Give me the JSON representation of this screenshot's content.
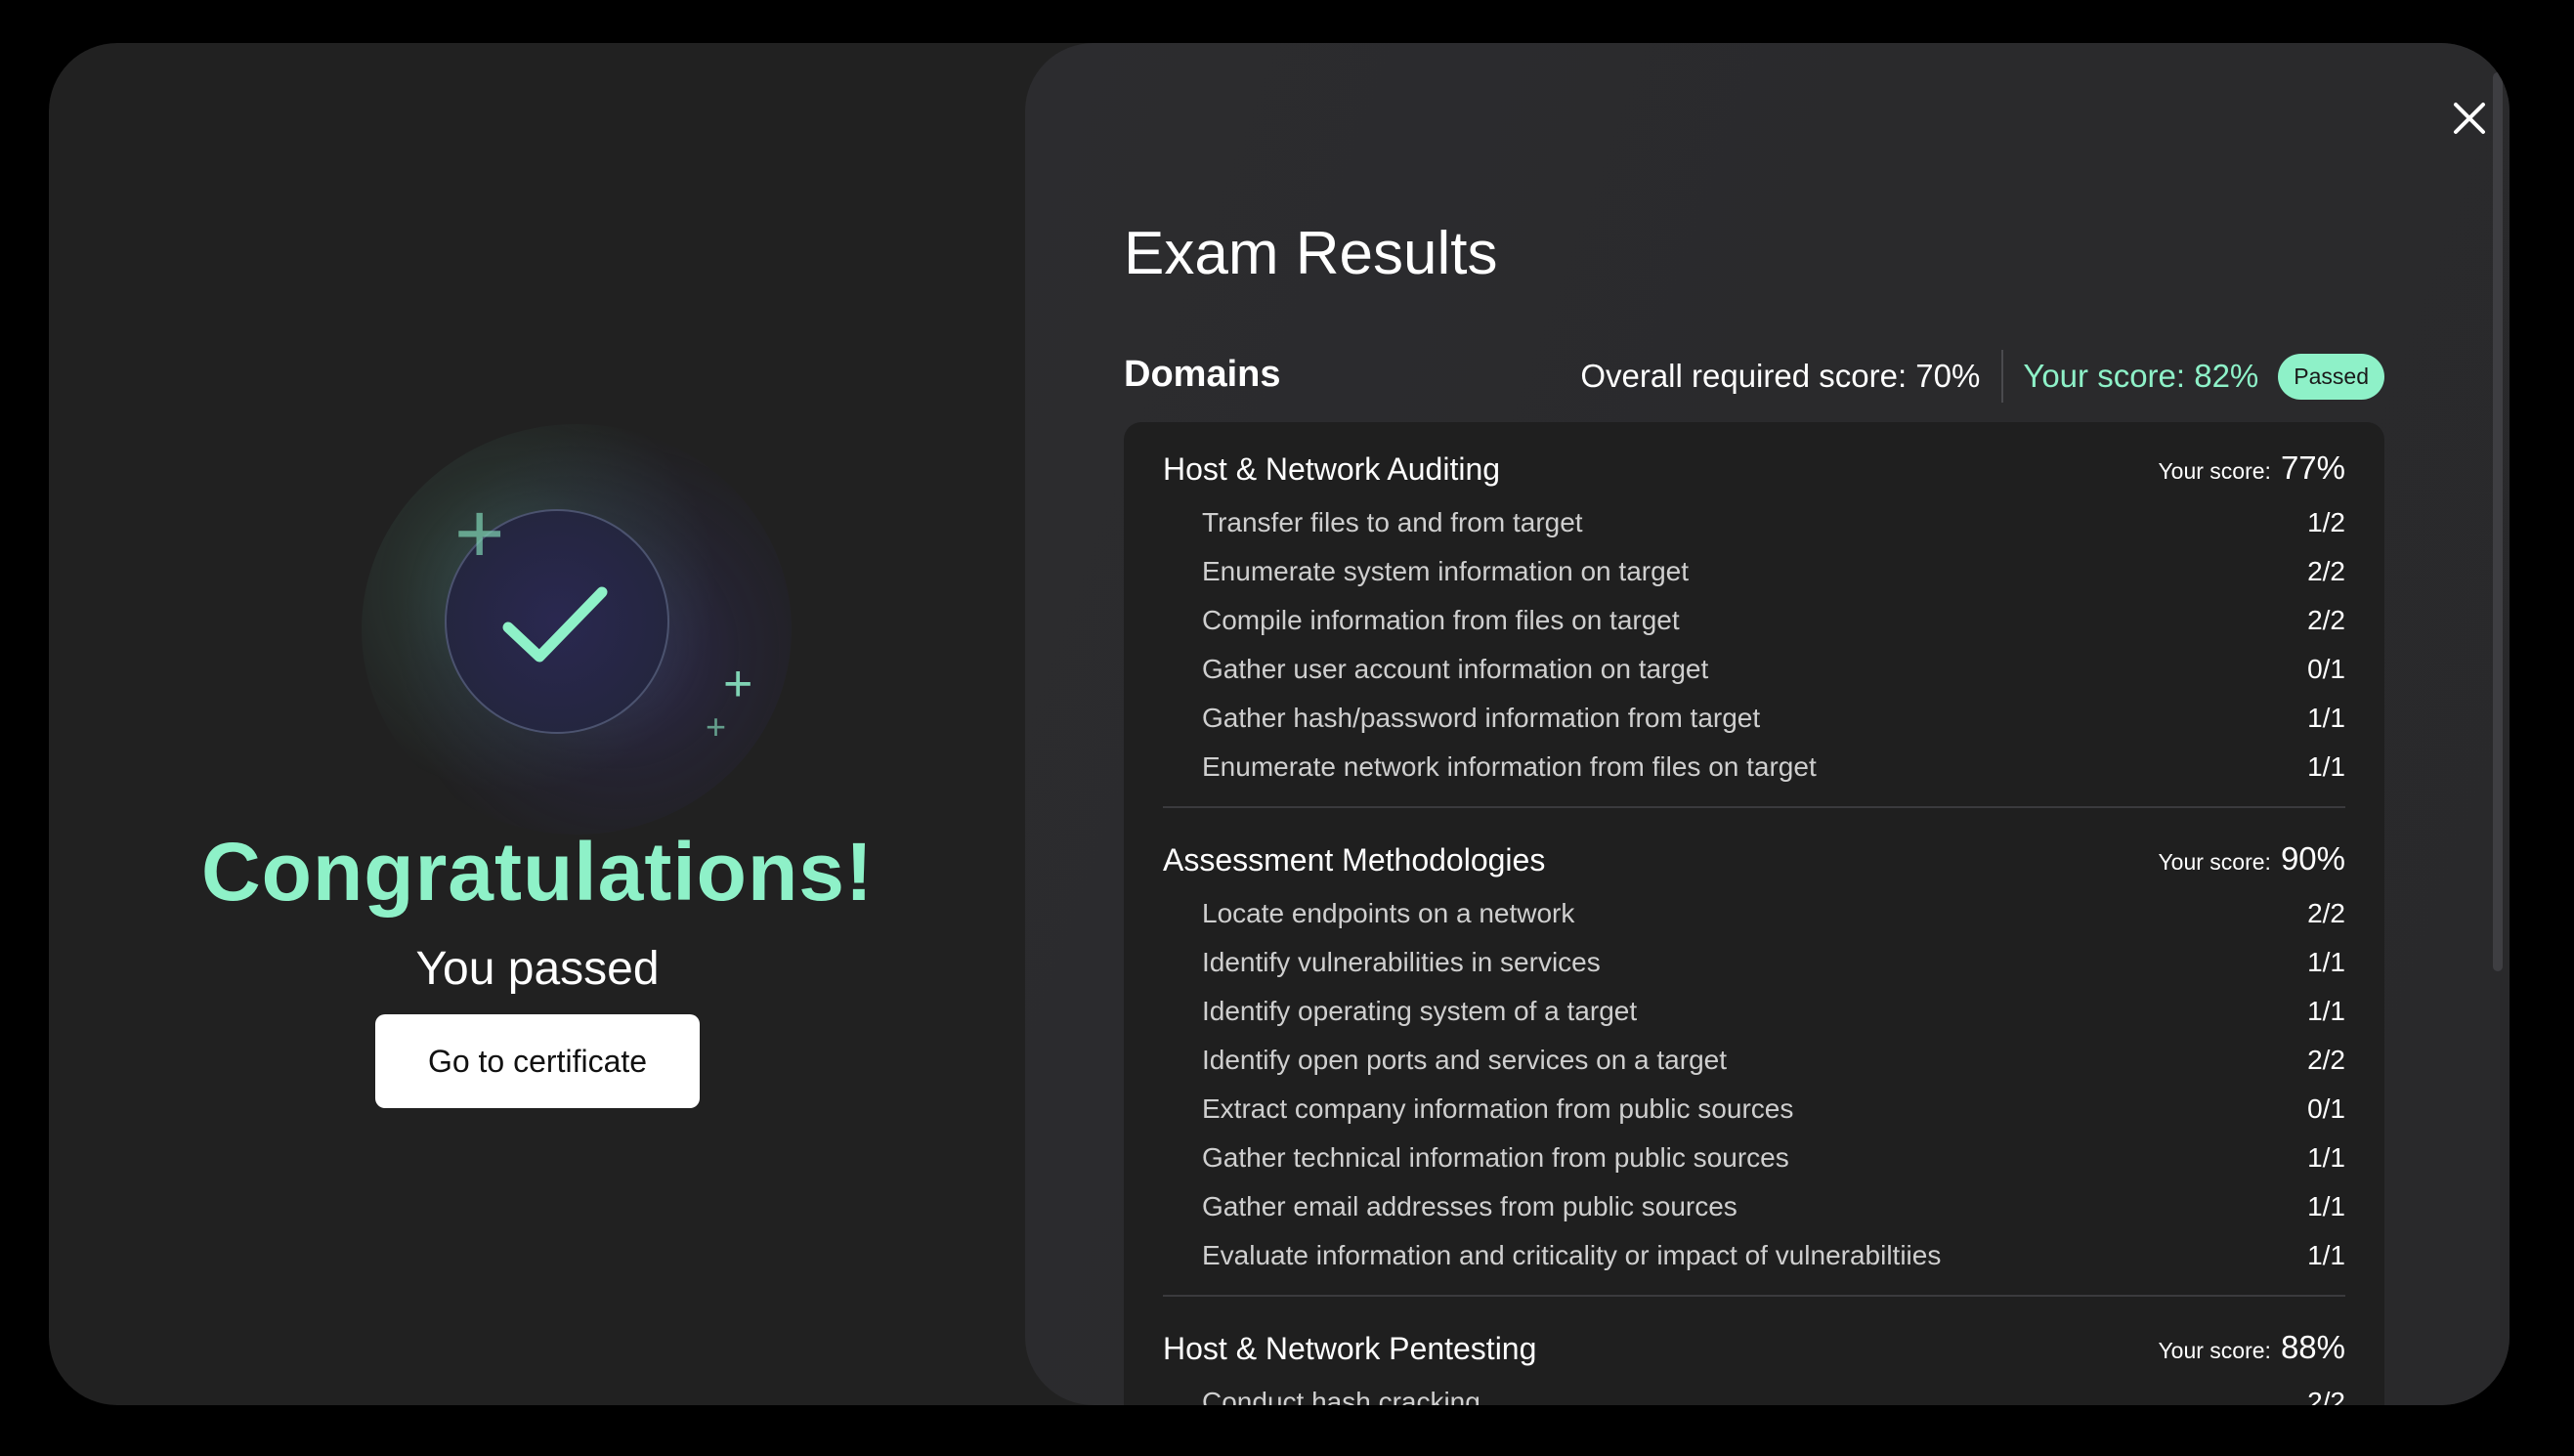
{
  "left": {
    "congrats": "Congratulations!",
    "subtitle": "You passed",
    "button_label": "Go to certificate",
    "icons": {
      "badge": "check-icon",
      "sparkles": "plus-sparkle-icon"
    }
  },
  "right": {
    "title": "Exam Results",
    "domains_label": "Domains",
    "required_score": "Overall required score: 70%",
    "your_score": "Your score: 82%",
    "status_badge": "Passed",
    "close_icon": "close-icon",
    "domains": [
      {
        "name": "Host & Network Auditing",
        "score_label": "Your score:",
        "score": "77%",
        "tasks": [
          {
            "name": "Transfer files to and from target",
            "value": "1/2"
          },
          {
            "name": "Enumerate system information on target",
            "value": "2/2"
          },
          {
            "name": "Compile information from files on target",
            "value": "2/2"
          },
          {
            "name": "Gather user account information on target",
            "value": "0/1"
          },
          {
            "name": "Gather hash/password information from target",
            "value": "1/1"
          },
          {
            "name": "Enumerate network information from files on target",
            "value": "1/1"
          }
        ]
      },
      {
        "name": "Assessment Methodologies",
        "score_label": "Your score:",
        "score": "90%",
        "tasks": [
          {
            "name": "Locate endpoints on a network",
            "value": "2/2"
          },
          {
            "name": "Identify vulnerabilities in services",
            "value": "1/1"
          },
          {
            "name": "Identify operating system of a target",
            "value": "1/1"
          },
          {
            "name": "Identify open ports and services on a target",
            "value": "2/2"
          },
          {
            "name": "Extract company information from public sources",
            "value": "0/1"
          },
          {
            "name": "Gather technical information from public sources",
            "value": "1/1"
          },
          {
            "name": "Gather email addresses from public sources",
            "value": "1/1"
          },
          {
            "name": "Evaluate information and criticality or impact of vulnerabiltiies",
            "value": "1/1"
          }
        ]
      },
      {
        "name": "Host & Network Pentesting",
        "score_label": "Your score:",
        "score": "88%",
        "tasks": [
          {
            "name": "Conduct hash cracking",
            "value": "2/2"
          }
        ]
      }
    ]
  },
  "colors": {
    "accent": "#8ef1c8",
    "modal_bg": "#212121",
    "panel_bg": "#1f1f1f"
  }
}
